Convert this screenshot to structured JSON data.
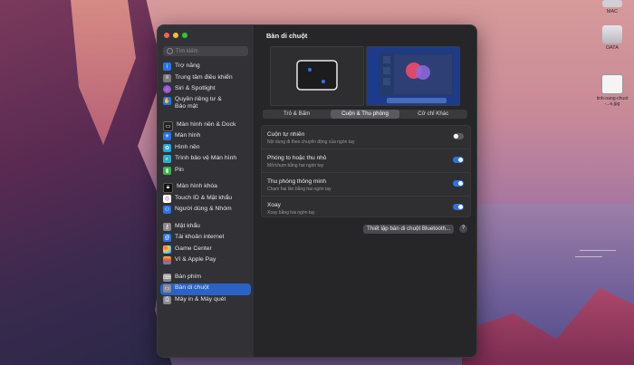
{
  "desktop": {
    "icons": [
      {
        "label": "MAC"
      },
      {
        "label": "DATA"
      },
      {
        "label": "tinh-nang-chuot-...e.jpg"
      }
    ]
  },
  "search": {
    "placeholder": "Tìm kiếm"
  },
  "sidebar": {
    "items": [
      {
        "label": "Trợ năng",
        "icon": "accessibility-icon",
        "color": "#2a73e6"
      },
      {
        "label": "Trung tâm điều khiển",
        "icon": "control-center-icon",
        "color": "#7a7a7e"
      },
      {
        "label": "Siri & Spotlight",
        "icon": "siri-icon",
        "color": "#b04ac8"
      },
      {
        "label": "Quyền riêng tư & Bảo mật",
        "icon": "privacy-hand-icon",
        "color": "#2a73e6"
      },
      {
        "label": "Màn hình nền & Dock",
        "icon": "dock-icon",
        "color": "#222"
      },
      {
        "label": "Màn hình",
        "icon": "display-icon",
        "color": "#2a73e6"
      },
      {
        "label": "Hình nền",
        "icon": "wallpaper-icon",
        "color": "#27a6e0"
      },
      {
        "label": "Trình bảo vệ Màn hình",
        "icon": "screensaver-icon",
        "color": "#2bb0c8"
      },
      {
        "label": "Pin",
        "icon": "battery-icon",
        "color": "#39b54a"
      },
      {
        "label": "Màn hình khóa",
        "icon": "lock-screen-icon",
        "color": "#111"
      },
      {
        "label": "Touch ID & Mật khẩu",
        "icon": "fingerprint-icon",
        "color": "#e0405a"
      },
      {
        "label": "Người dùng & Nhóm",
        "icon": "users-icon",
        "color": "#2a73e6"
      },
      {
        "label": "Mật khẩu",
        "icon": "key-icon",
        "color": "#8a8a8e"
      },
      {
        "label": "Tài khoản internet",
        "icon": "at-icon",
        "color": "#2a73e6"
      },
      {
        "label": "Game Center",
        "icon": "game-center-icon",
        "color": "#e8e8e8"
      },
      {
        "label": "Ví & Apple Pay",
        "icon": "wallet-icon",
        "color": "#222"
      },
      {
        "label": "Bàn phím",
        "icon": "keyboard-icon",
        "color": "#8a8a8e"
      },
      {
        "label": "Bàn di chuột",
        "icon": "trackpad-icon",
        "color": "#8a8a8e"
      },
      {
        "label": "Máy in & Máy quét",
        "icon": "printer-icon",
        "color": "#8a8a8e"
      }
    ]
  },
  "main": {
    "title": "Bàn di chuột",
    "tabs": [
      {
        "label": "Trỏ & Bấm"
      },
      {
        "label": "Cuộn & Thu phóng"
      },
      {
        "label": "Cử chỉ Khác"
      }
    ],
    "rows": [
      {
        "title": "Cuộn tự nhiên",
        "subtitle": "Nội dung đi theo chuyển động của ngón tay",
        "on": false
      },
      {
        "title": "Phóng to hoặc thu nhỏ",
        "subtitle": "Mở/chụm bằng hai ngón tay",
        "on": true
      },
      {
        "title": "Thu phóng thông minh",
        "subtitle": "Chạm hai lần bằng hai ngón tay",
        "on": true
      },
      {
        "title": "Xoay",
        "subtitle": "Xoay bằng hai ngón tay",
        "on": true
      }
    ],
    "bluetooth_button": "Thiết lập bàn di chuột Bluetooth...",
    "help": "?"
  },
  "colors": {
    "accent": "#2a73e6",
    "selected": "#2b63c4"
  }
}
